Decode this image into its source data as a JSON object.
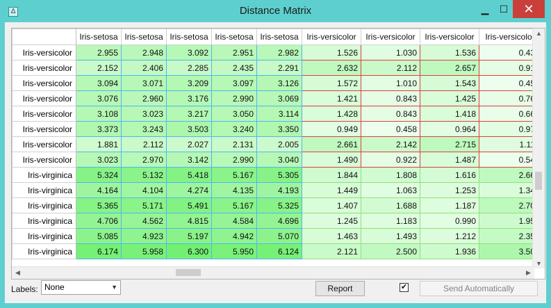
{
  "window": {
    "title": "Distance Matrix"
  },
  "icons": {
    "app": "orange-app-icon",
    "minimize": "minimize-icon",
    "maximize": "maximize-icon",
    "close": "close-icon"
  },
  "window_controls": {
    "minimize_glyph": "▁",
    "maximize_glyph": "☐",
    "close_glyph": "✕"
  },
  "matrix": {
    "col_headers": [
      "Iris-setosa",
      "Iris-setosa",
      "Iris-setosa",
      "Iris-setosa",
      "Iris-setosa",
      "Iris-versicolor",
      "Iris-versicolor",
      "Iris-versicolor",
      "Iris-versicolo"
    ],
    "rows": [
      {
        "label": "Iris-versicolor",
        "values": [
          "2.955",
          "2.948",
          "3.092",
          "2.951",
          "2.982",
          "1.526",
          "1.030",
          "1.536",
          "0.43"
        ]
      },
      {
        "label": "Iris-versicolor",
        "values": [
          "2.152",
          "2.406",
          "2.285",
          "2.435",
          "2.291",
          "2.632",
          "2.112",
          "2.657",
          "0.91"
        ]
      },
      {
        "label": "Iris-versicolor",
        "values": [
          "3.094",
          "3.071",
          "3.209",
          "3.097",
          "3.126",
          "1.572",
          "1.010",
          "1.543",
          "0.45"
        ]
      },
      {
        "label": "Iris-versicolor",
        "values": [
          "3.076",
          "2.960",
          "3.176",
          "2.990",
          "3.069",
          "1.421",
          "0.843",
          "1.425",
          "0.76"
        ]
      },
      {
        "label": "Iris-versicolor",
        "values": [
          "3.108",
          "3.023",
          "3.217",
          "3.050",
          "3.114",
          "1.428",
          "0.843",
          "1.418",
          "0.66"
        ]
      },
      {
        "label": "Iris-versicolor",
        "values": [
          "3.373",
          "3.243",
          "3.503",
          "3.240",
          "3.350",
          "0.949",
          "0.458",
          "0.964",
          "0.97"
        ]
      },
      {
        "label": "Iris-versicolor",
        "values": [
          "1.881",
          "2.112",
          "2.027",
          "2.131",
          "2.005",
          "2.661",
          "2.142",
          "2.715",
          "1.11"
        ]
      },
      {
        "label": "Iris-versicolor",
        "values": [
          "3.023",
          "2.970",
          "3.142",
          "2.990",
          "3.040",
          "1.490",
          "0.922",
          "1.487",
          "0.54"
        ]
      },
      {
        "label": "Iris-virginica",
        "values": [
          "5.324",
          "5.132",
          "5.418",
          "5.167",
          "5.305",
          "1.844",
          "1.808",
          "1.616",
          "2.66"
        ]
      },
      {
        "label": "Iris-virginica",
        "values": [
          "4.164",
          "4.104",
          "4.274",
          "4.135",
          "4.193",
          "1.449",
          "1.063",
          "1.253",
          "1.34"
        ]
      },
      {
        "label": "Iris-virginica",
        "values": [
          "5.365",
          "5.171",
          "5.491",
          "5.167",
          "5.325",
          "1.407",
          "1.688",
          "1.187",
          "2.70"
        ]
      },
      {
        "label": "Iris-virginica",
        "values": [
          "4.706",
          "4.562",
          "4.815",
          "4.584",
          "4.696",
          "1.245",
          "1.183",
          "0.990",
          "1.95"
        ]
      },
      {
        "label": "Iris-virginica",
        "values": [
          "5.085",
          "4.923",
          "5.197",
          "4.942",
          "5.070",
          "1.463",
          "1.493",
          "1.212",
          "2.35"
        ]
      },
      {
        "label": "Iris-virginica",
        "values": [
          "6.174",
          "5.958",
          "6.300",
          "5.950",
          "6.124",
          "2.121",
          "2.500",
          "1.936",
          "3.50"
        ]
      }
    ],
    "color_scale": {
      "low": "#f7fff7",
      "high": "#6ef06e",
      "max_value": 6.5
    },
    "group_border_colors": {
      "setosa": "#4fb6ee",
      "versicolor": "#d9413d",
      "virginica": "#8fe07a"
    },
    "scrollbar_arrows": {
      "up": "▲",
      "down": "▼",
      "left": "◀",
      "right": "▶"
    }
  },
  "controls": {
    "labels_caption": "Labels:",
    "labels_selected": "None",
    "report_label": "Report",
    "auto_send_checked": true,
    "check_glyph": "✔",
    "send_label": "Send Automatically",
    "dropdown_caret": "▼"
  }
}
